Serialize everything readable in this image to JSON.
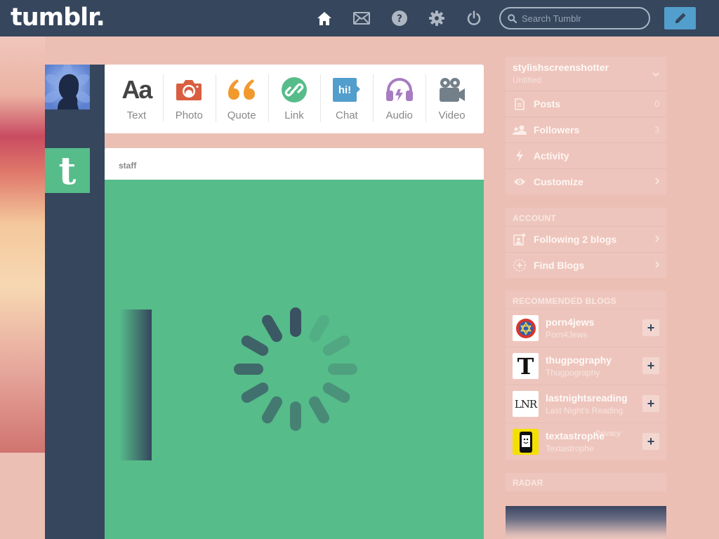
{
  "header": {
    "logo": "tumblr.",
    "search_placeholder": "Search Tumblr",
    "nav_icons": [
      "home-icon",
      "mail-icon",
      "help-icon",
      "gear-icon",
      "power-icon"
    ],
    "compose_icon": "pencil-icon"
  },
  "post_types": [
    {
      "label": "Text",
      "icon": "text-icon",
      "color": "#444444"
    },
    {
      "label": "Photo",
      "icon": "camera-icon",
      "color": "#d95e40"
    },
    {
      "label": "Quote",
      "icon": "quote-icon",
      "color": "#f2992e"
    },
    {
      "label": "Link",
      "icon": "link-icon",
      "color": "#56bc8a"
    },
    {
      "label": "Chat",
      "icon": "chat-icon",
      "color": "#529ecc"
    },
    {
      "label": "Audio",
      "icon": "headphones-icon",
      "color": "#a77dc2"
    },
    {
      "label": "Video",
      "icon": "video-camera-icon",
      "color": "#748089"
    }
  ],
  "post": {
    "author": "staff",
    "background_color": "#56bc8a",
    "avatar_glyph": "t"
  },
  "sidebar": {
    "blog": {
      "name": "stylishscreenshotter",
      "title": "Untitled"
    },
    "menu": [
      {
        "label": "Posts",
        "icon": "document-icon",
        "count": "0"
      },
      {
        "label": "Followers",
        "icon": "people-icon",
        "count": "3"
      },
      {
        "label": "Activity",
        "icon": "lightning-icon"
      },
      {
        "label": "Customize",
        "icon": "eye-icon"
      }
    ],
    "account_title": "ACCOUNT",
    "account": [
      {
        "label": "Following 2 blogs",
        "icon": "add-person-icon"
      },
      {
        "label": "Find Blogs",
        "icon": "compass-icon"
      }
    ],
    "recommended_title": "RECOMMENDED BLOGS",
    "recommended": [
      {
        "name": "porn4jews",
        "title": "Porn4Jews",
        "avatar": "star-emblem"
      },
      {
        "name": "thugpography",
        "title": "Thugpography",
        "avatar_text": "T"
      },
      {
        "name": "lastnightsreading",
        "title": "Last Night's Reading",
        "avatar_text": "LNR"
      },
      {
        "name": "textastrophe",
        "title": "Textastrophe",
        "avatar": "phone-icon"
      }
    ],
    "add_label": "+",
    "overlay_text": "Privacy",
    "radar_title": "RADAR"
  },
  "colors": {
    "navy": "#36465d",
    "page_bg": "#ecbfb5",
    "accent_blue": "#529ecc",
    "staff_green": "#56bc8a"
  }
}
